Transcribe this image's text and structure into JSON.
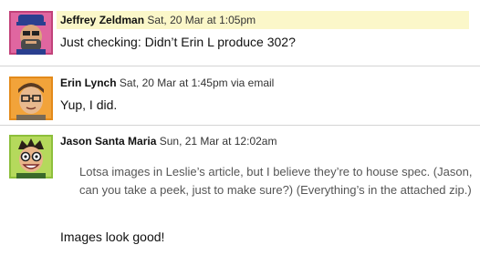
{
  "comments": [
    {
      "author": "Jeffrey Zeldman",
      "timestamp": "Sat, 20 Mar at 1:05pm",
      "via": "",
      "text": "Just checking: Didn’t Erin L produce 302?",
      "avatar_icon": "jeffrey-zeldman-avatar-icon",
      "highlight_color": "#fbf7c9"
    },
    {
      "author": "Erin Lynch",
      "timestamp": "Sat, 20 Mar at 1:45pm",
      "via": "via email",
      "text": "Yup, I did.",
      "avatar_icon": "erin-lynch-avatar-icon"
    },
    {
      "author": "Jason Santa Maria",
      "timestamp": "Sun, 21 Mar at 12:02am",
      "via": "",
      "quote": "Lotsa images in Leslie’s article, but I believe they’re to house spec. (Jason, can you take a peek, just to make sure?) (Everything’s in the attached zip.)",
      "text": "Images look good!",
      "avatar_icon": "jason-santa-maria-avatar-icon"
    }
  ]
}
